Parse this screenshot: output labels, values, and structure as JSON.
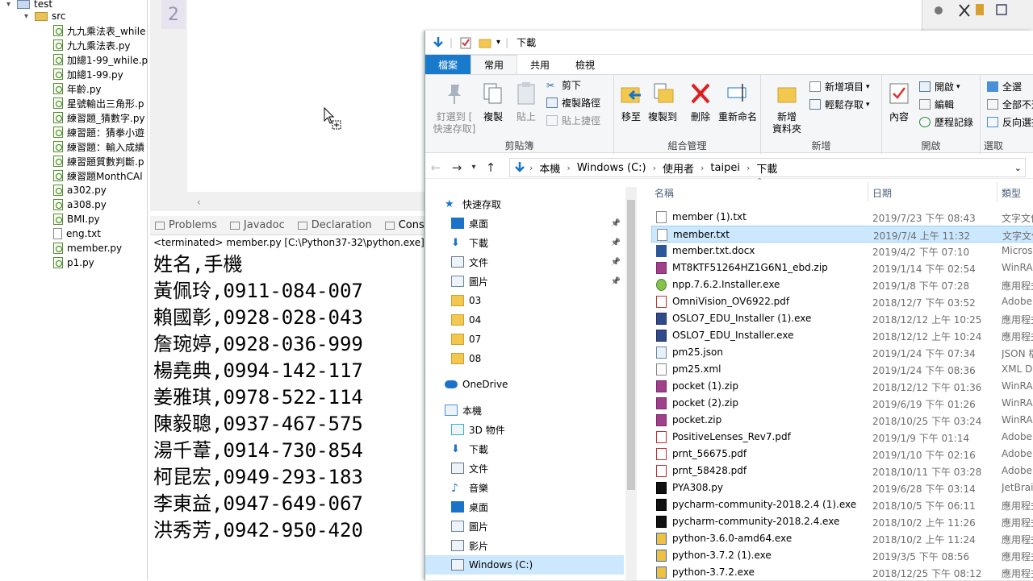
{
  "tree": {
    "project": "test",
    "src": "src",
    "files": [
      {
        "name": "九九乘法表_while",
        "kind": "py"
      },
      {
        "name": "九九乘法表.py",
        "kind": "py"
      },
      {
        "name": "加總1-99_while.p",
        "kind": "py"
      },
      {
        "name": "加總1-99.py",
        "kind": "py"
      },
      {
        "name": "年齡.py",
        "kind": "py"
      },
      {
        "name": "星號輸出三角形.p",
        "kind": "py"
      },
      {
        "name": "練習題_猜數字.py",
        "kind": "py"
      },
      {
        "name": "練習題：猜拳小遊",
        "kind": "py"
      },
      {
        "name": "練習題：輸入成績",
        "kind": "py"
      },
      {
        "name": "練習題質數判斷.p",
        "kind": "py"
      },
      {
        "name": "練習題MonthCAl",
        "kind": "py"
      },
      {
        "name": "a302.py",
        "kind": "py"
      },
      {
        "name": "a308.py",
        "kind": "py"
      },
      {
        "name": "BMI.py",
        "kind": "py"
      },
      {
        "name": "eng.txt",
        "kind": "txt"
      },
      {
        "name": "member.py",
        "kind": "py"
      },
      {
        "name": "p1.py",
        "kind": "py"
      }
    ]
  },
  "editor": {
    "line_number": "2"
  },
  "console": {
    "tabs": [
      {
        "label": "Problems",
        "active": false
      },
      {
        "label": "Javadoc",
        "active": false
      },
      {
        "label": "Declaration",
        "active": false
      },
      {
        "label": "Console",
        "active": true
      }
    ],
    "close": "✕",
    "terminated": "<terminated> member.py [C:\\Python37-32\\python.exe]",
    "output": [
      "姓名,手機",
      "黃佩玲,0911-084-007",
      "賴國彰,0928-028-043",
      "詹琬婷,0928-036-999",
      "楊堯典,0994-142-117",
      "姜雅琪,0978-522-114",
      "陳毅聰,0937-467-575",
      "湯千葦,0914-730-854",
      "柯昆宏,0949-293-183",
      "李東益,0947-649-067",
      "洪秀芳,0942-950-420"
    ]
  },
  "explorer": {
    "title": "下載",
    "ribbon_tabs": [
      {
        "label": "檔案",
        "style": "file"
      },
      {
        "label": "常用",
        "style": "home"
      },
      {
        "label": "共用",
        "style": "normal"
      },
      {
        "label": "檢視",
        "style": "normal"
      }
    ],
    "groups": {
      "clipboard": {
        "label": "剪貼簿",
        "pin_l1": "釘選到 [",
        "pin_l2": "快速存取]",
        "copy": "複製",
        "paste": "貼上",
        "cut": "剪下",
        "copy_path": "複製路徑",
        "paste_shortcut": "貼上捷徑"
      },
      "organize": {
        "label": "組合管理",
        "move_to": "移至",
        "copy_to": "複製到",
        "delete": "刪除",
        "rename": "重新命名"
      },
      "new": {
        "label": "新增",
        "new_folder_l1": "新增",
        "new_folder_l2": "資料夾",
        "new_item": "新增項目",
        "easy_access": "輕鬆存取"
      },
      "open": {
        "label": "開啟",
        "properties": "內容",
        "open": "開啟",
        "edit": "編輯",
        "history": "歷程記錄"
      },
      "select": {
        "label": "選取",
        "all": "全選",
        "none": "全部不選",
        "invert": "反向選擇"
      }
    },
    "address": {
      "crumbs": [
        "本機",
        "Windows (C:)",
        "使用者",
        "taipei",
        "下載"
      ]
    },
    "nav": [
      {
        "label": "快速存取",
        "icon": "star-icon",
        "indent": 0,
        "pin": false
      },
      {
        "label": "桌面",
        "icon": "desktop-icon",
        "indent": 1,
        "pin": true
      },
      {
        "label": "下載",
        "icon": "download-icon",
        "indent": 1,
        "pin": true
      },
      {
        "label": "文件",
        "icon": "document-icon",
        "indent": 1,
        "pin": true
      },
      {
        "label": "圖片",
        "icon": "picture-icon",
        "indent": 1,
        "pin": true
      },
      {
        "label": "03",
        "icon": "folder-icon",
        "indent": 1,
        "pin": false
      },
      {
        "label": "04",
        "icon": "folder-icon",
        "indent": 1,
        "pin": false
      },
      {
        "label": "07",
        "icon": "folder-icon",
        "indent": 1,
        "pin": false
      },
      {
        "label": "08",
        "icon": "folder-icon",
        "indent": 1,
        "pin": false
      },
      {
        "label": "OneDrive",
        "icon": "cloud-icon",
        "indent": 0,
        "pin": false
      },
      {
        "label": "本機",
        "icon": "computer-icon",
        "indent": 0,
        "pin": false
      },
      {
        "label": "3D 物件",
        "icon": "cube-icon",
        "indent": 1,
        "pin": false
      },
      {
        "label": "下載",
        "icon": "download-icon",
        "indent": 1,
        "pin": false
      },
      {
        "label": "文件",
        "icon": "document-icon",
        "indent": 1,
        "pin": false
      },
      {
        "label": "音樂",
        "icon": "music-icon",
        "indent": 1,
        "pin": false
      },
      {
        "label": "桌面",
        "icon": "desktop-icon",
        "indent": 1,
        "pin": false
      },
      {
        "label": "圖片",
        "icon": "picture-icon",
        "indent": 1,
        "pin": false
      },
      {
        "label": "影片",
        "icon": "video-icon",
        "indent": 1,
        "pin": false
      },
      {
        "label": "Windows (C:)",
        "icon": "drive-icon",
        "indent": 1,
        "pin": false,
        "selected": true
      }
    ],
    "columns": {
      "name": "名稱",
      "date": "日期",
      "type": "類型"
    },
    "files": [
      {
        "name": "member (1).txt",
        "date": "2019/7/23 下午 08:43",
        "type": "文字文件",
        "icon": "txt",
        "selected": false
      },
      {
        "name": "member.txt",
        "date": "2019/7/4 上午 11:32",
        "type": "文字文件",
        "icon": "txt",
        "selected": true
      },
      {
        "name": "member.txt.docx",
        "date": "2019/4/2 下午 07:10",
        "type": "Microsoft",
        "icon": "docx",
        "selected": false
      },
      {
        "name": "MT8KTF51264HZ1G6N1_ebd.zip",
        "date": "2019/1/14 下午 02:54",
        "type": "WinRAR",
        "icon": "zip",
        "selected": false
      },
      {
        "name": "npp.7.6.2.Installer.exe",
        "date": "2019/1/8 下午 07:28",
        "type": "應用程式",
        "icon": "exe",
        "selected": false
      },
      {
        "name": "OmniVision_OV6922.pdf",
        "date": "2018/12/7 下午 03:52",
        "type": "Adobe",
        "icon": "pdf",
        "selected": false
      },
      {
        "name": "OSLO7_EDU_Installer (1).exe",
        "date": "2018/12/12 上午 10:25",
        "type": "應用程式",
        "icon": "exe2",
        "selected": false
      },
      {
        "name": "OSLO7_EDU_Installer.exe",
        "date": "2018/12/12 上午 10:24",
        "type": "應用程式",
        "icon": "exe2",
        "selected": false
      },
      {
        "name": "pm25.json",
        "date": "2019/1/24 下午 07:34",
        "type": "JSON 檔案",
        "icon": "json",
        "selected": false
      },
      {
        "name": "pm25.xml",
        "date": "2019/1/24 下午 08:36",
        "type": "XML Do",
        "icon": "txt",
        "selected": false
      },
      {
        "name": "pocket (1).zip",
        "date": "2018/12/12 下午 01:36",
        "type": "WinRAR",
        "icon": "zip",
        "selected": false
      },
      {
        "name": "pocket (2).zip",
        "date": "2019/6/19 下午 01:26",
        "type": "WinRAR",
        "icon": "zip",
        "selected": false
      },
      {
        "name": "pocket.zip",
        "date": "2018/10/25 下午 03:24",
        "type": "WinRAR",
        "icon": "zip",
        "selected": false
      },
      {
        "name": "PositiveLenses_Rev7.pdf",
        "date": "2019/1/9 下午 01:14",
        "type": "Adobe",
        "icon": "pdf",
        "selected": false
      },
      {
        "name": "prnt_56675.pdf",
        "date": "2019/1/10 下午 02:16",
        "type": "Adobe",
        "icon": "pdf",
        "selected": false
      },
      {
        "name": "prnt_58428.pdf",
        "date": "2018/10/11 下午 03:28",
        "type": "Adobe",
        "icon": "pdf",
        "selected": false
      },
      {
        "name": "PYA308.py",
        "date": "2019/6/28 下午 03:14",
        "type": "JetBrains",
        "icon": "pc",
        "selected": false
      },
      {
        "name": "pycharm-community-2018.2.4 (1).exe",
        "date": "2018/10/5 下午 06:11",
        "type": "應用程式",
        "icon": "pc",
        "selected": false
      },
      {
        "name": "pycharm-community-2018.2.4.exe",
        "date": "2018/10/2 上午 11:26",
        "type": "應用程式",
        "icon": "pc",
        "selected": false
      },
      {
        "name": "python-3.6.0-amd64.exe",
        "date": "2018/10/2 上午 11:24",
        "type": "應用程式",
        "icon": "py",
        "selected": false
      },
      {
        "name": "python-3.7.2 (1).exe",
        "date": "2019/3/5 下午 08:56",
        "type": "應用程式",
        "icon": "py",
        "selected": false
      },
      {
        "name": "python-3.7.2.exe",
        "date": "2018/12/25 下午 08:12",
        "type": "應用程式",
        "icon": "py",
        "selected": false
      }
    ]
  }
}
